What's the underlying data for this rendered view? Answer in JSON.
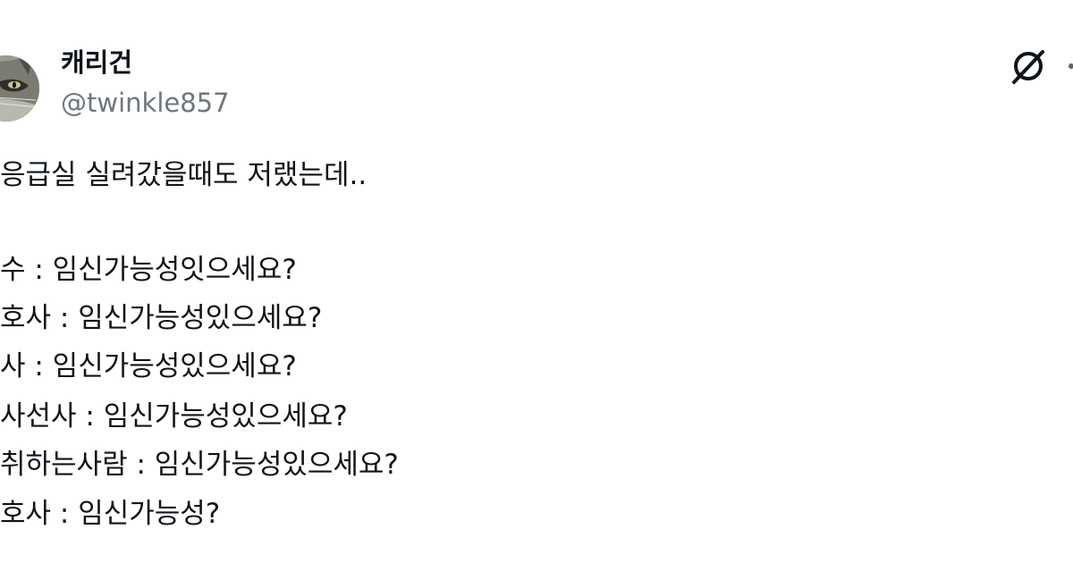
{
  "author": {
    "display_name": "캐리건",
    "handle": "@twinkle857",
    "avatar_icon": "cat-avatar-icon"
  },
  "actions": {
    "grok_icon": "grok-icon",
    "more_icon": "more-options-icon"
  },
  "tweet": {
    "lines": [
      "응급실 실려갔을때도 저랬는데..",
      "수 : 임신가능성잇으세요?",
      "호사 : 임신가능성있으세요?",
      "사 : 임신가능성있으세요?",
      "사선사 : 임신가능성있으세요?",
      "취하는사람 : 임신가능성있으세요?",
      "호사 : 임신가능성?"
    ]
  },
  "colors": {
    "text": "#0f1419",
    "secondary_text": "#6f767c",
    "background": "#ffffff"
  }
}
